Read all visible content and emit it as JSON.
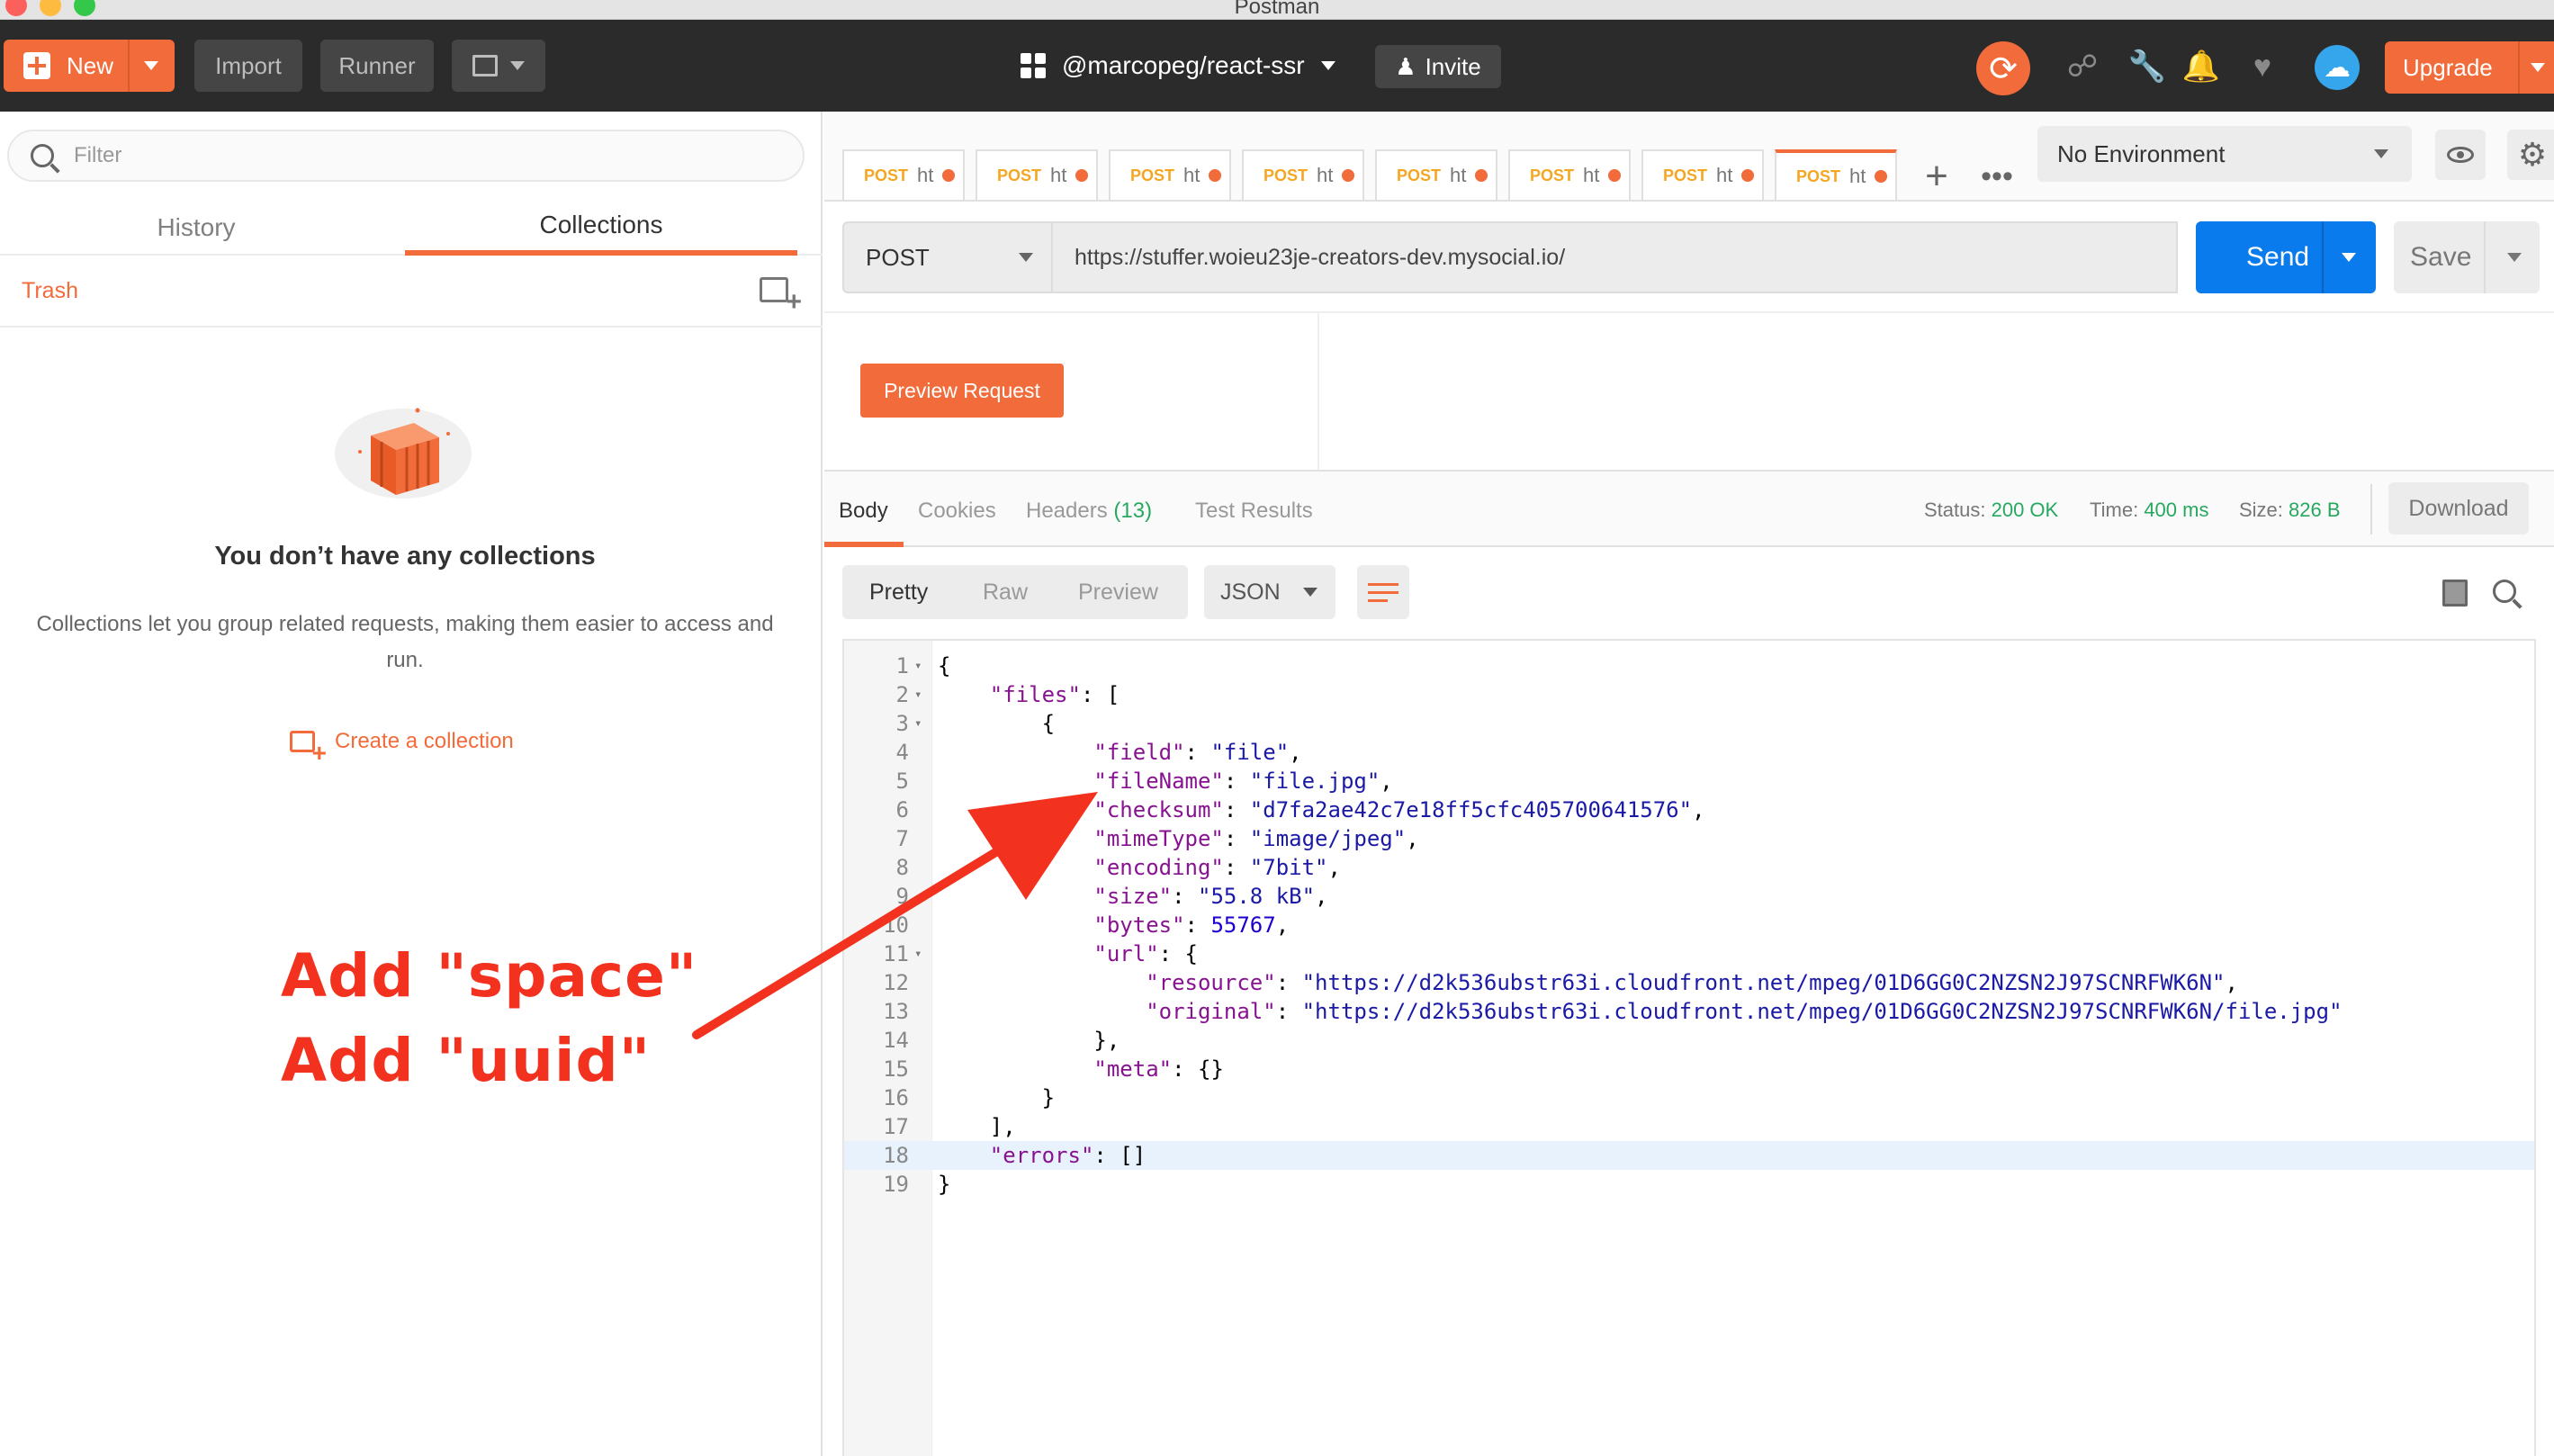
{
  "window": {
    "title": "Postman"
  },
  "toolbar": {
    "new_label": "New",
    "import_label": "Import",
    "runner_label": "Runner",
    "workspace_name": "@marcopeg/react-ssr",
    "invite_label": "Invite",
    "upgrade_label": "Upgrade"
  },
  "sidebar": {
    "filter_placeholder": "Filter",
    "tabs": [
      {
        "label": "History"
      },
      {
        "label": "Collections"
      }
    ],
    "active_tab": "Collections",
    "trash_label": "Trash",
    "empty_title": "You don’t have any collections",
    "empty_description": "Collections let you group related requests, making them easier to access and run.",
    "create_label": "Create a collection"
  },
  "request_tabs": {
    "tabs": [
      {
        "method": "POST",
        "url": "ht"
      },
      {
        "method": "POST",
        "url": "ht"
      },
      {
        "method": "POST",
        "url": "ht"
      },
      {
        "method": "POST",
        "url": "ht"
      },
      {
        "method": "POST",
        "url": "ht"
      },
      {
        "method": "POST",
        "url": "ht"
      },
      {
        "method": "POST",
        "url": "ht"
      },
      {
        "method": "POST",
        "url": "ht"
      }
    ],
    "active_index": 7
  },
  "environment": {
    "selected": "No Environment"
  },
  "request": {
    "method": "POST",
    "url": "https://stuffer.woieu23je-creators-dev.mysocial.io/",
    "send_label": "Send",
    "save_label": "Save",
    "preview_label": "Preview Request"
  },
  "response": {
    "tabs": [
      {
        "label": "Body"
      },
      {
        "label": "Cookies"
      },
      {
        "label": "Headers",
        "count": "(13)"
      },
      {
        "label": "Test Results"
      }
    ],
    "status_label": "Status:",
    "status_value": "200 OK",
    "time_label": "Time:",
    "time_value": "400 ms",
    "size_label": "Size:",
    "size_value": "826 B",
    "download_label": "Download",
    "format_options": [
      "Pretty",
      "Raw",
      "Preview"
    ],
    "active_format": "Pretty",
    "language": "JSON"
  },
  "code": {
    "lines": [
      {
        "n": "1",
        "fold": true,
        "text": "{"
      },
      {
        "n": "2",
        "fold": true,
        "text": "    \"files\": ["
      },
      {
        "n": "3",
        "fold": true,
        "text": "        {"
      },
      {
        "n": "4",
        "fold": false,
        "text": "            \"field\": \"file\","
      },
      {
        "n": "5",
        "fold": false,
        "text": "            \"fileName\": \"file.jpg\","
      },
      {
        "n": "6",
        "fold": false,
        "text": "            \"checksum\": \"d7fa2ae42c7e18ff5cfc405700641576\","
      },
      {
        "n": "7",
        "fold": false,
        "text": "            \"mimeType\": \"image/jpeg\","
      },
      {
        "n": "8",
        "fold": false,
        "text": "            \"encoding\": \"7bit\","
      },
      {
        "n": "9",
        "fold": false,
        "text": "            \"size\": \"55.8 kB\","
      },
      {
        "n": "10",
        "fold": false,
        "text": "            \"bytes\": 55767,"
      },
      {
        "n": "11",
        "fold": true,
        "text": "            \"url\": {"
      },
      {
        "n": "12",
        "fold": false,
        "text": "                \"resource\": \"https://d2k536ubstr63i.cloudfront.net/mpeg/01D6GG0C2NZSN2J97SCNRFWK6N\","
      },
      {
        "n": "13",
        "fold": false,
        "text": "                \"original\": \"https://d2k536ubstr63i.cloudfront.net/mpeg/01D6GG0C2NZSN2J97SCNRFWK6N/file.jpg\""
      },
      {
        "n": "14",
        "fold": false,
        "text": "            },"
      },
      {
        "n": "15",
        "fold": false,
        "text": "            \"meta\": {}"
      },
      {
        "n": "16",
        "fold": false,
        "text": "        }"
      },
      {
        "n": "17",
        "fold": false,
        "text": "    ],"
      },
      {
        "n": "18",
        "fold": false,
        "text": "    \"errors\": []"
      },
      {
        "n": "19",
        "fold": false,
        "text": "}"
      }
    ],
    "highlighted_line": 18
  },
  "annotation": {
    "line1": "Add \"space\"",
    "line2": "Add \"uuid\"",
    "color": "#f2321e"
  },
  "colors": {
    "brand_orange": "#f26b3a",
    "send_blue": "#097bed",
    "status_green": "#27a85f"
  }
}
